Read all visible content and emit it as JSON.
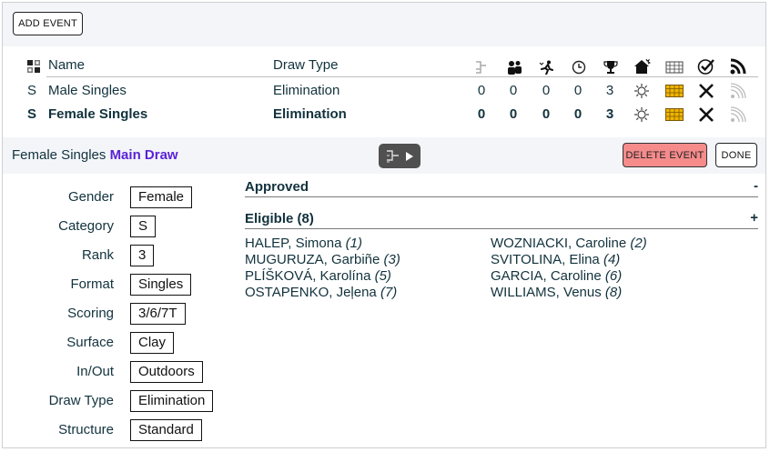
{
  "toolbar": {
    "add_event_label": "ADD EVENT"
  },
  "events_table": {
    "headers": {
      "type_col": "",
      "name": "Name",
      "draw_type": "Draw Type"
    },
    "rows": [
      {
        "type": "S",
        "name": "Male Singles",
        "draw_type": "Elimination",
        "counts": [
          "0",
          "0",
          "0",
          "0",
          "3"
        ],
        "bold": false
      },
      {
        "type": "S",
        "name": "Female Singles",
        "draw_type": "Elimination",
        "counts": [
          "0",
          "0",
          "0",
          "0",
          "3"
        ],
        "bold": true
      }
    ],
    "header_icons": [
      "draw-bracket-icon",
      "players-icon",
      "ranked-player-icon",
      "clock-icon",
      "trophy-icon",
      "venue-house-icon",
      "court-grid-icon",
      "approved-check-icon",
      "broadcast-rss-icon"
    ],
    "row_icons": [
      "weather-sun-icon",
      "court-grid-icon",
      "delete-x-icon",
      "broadcast-rss-icon"
    ]
  },
  "draw_bar": {
    "event_name": "Female Singles",
    "draw_name": "Main Draw",
    "delete_label": "DELETE EVENT",
    "done_label": "DONE"
  },
  "details": [
    {
      "label": "Gender",
      "value": "Female"
    },
    {
      "label": "Category",
      "value": "S"
    },
    {
      "label": "Rank",
      "value": "3"
    },
    {
      "label": "Format",
      "value": "Singles"
    },
    {
      "label": "Scoring",
      "value": "3/6/7T"
    },
    {
      "label": "Surface",
      "value": "Clay"
    },
    {
      "label": "In/Out",
      "value": "Outdoors"
    },
    {
      "label": "Draw Type",
      "value": "Elimination"
    },
    {
      "label": "Structure",
      "value": "Standard"
    }
  ],
  "approved": {
    "title": "Approved",
    "toggle": "-"
  },
  "eligible": {
    "title": "Eligible (8)",
    "toggle": "+",
    "players": [
      {
        "name": "HALEP, Simona",
        "seed": "(1)"
      },
      {
        "name": "WOZNIACKI, Caroline",
        "seed": "(2)"
      },
      {
        "name": "MUGURUZA, Garbiñe",
        "seed": "(3)"
      },
      {
        "name": "SVITOLINA, Elina",
        "seed": "(4)"
      },
      {
        "name": "PLÍŠKOVÁ, Karolína",
        "seed": "(5)"
      },
      {
        "name": "GARCIA, Caroline",
        "seed": "(6)"
      },
      {
        "name": "OSTAPENKO, Jeļena",
        "seed": "(7)"
      },
      {
        "name": "WILLIAMS, Venus",
        "seed": "(8)"
      }
    ]
  },
  "colors": {
    "accent_purple": "#5a22d6",
    "delete_red": "#f58b8b",
    "court_yellow": "#f0b400",
    "panel_bg": "#f3f5f9"
  }
}
